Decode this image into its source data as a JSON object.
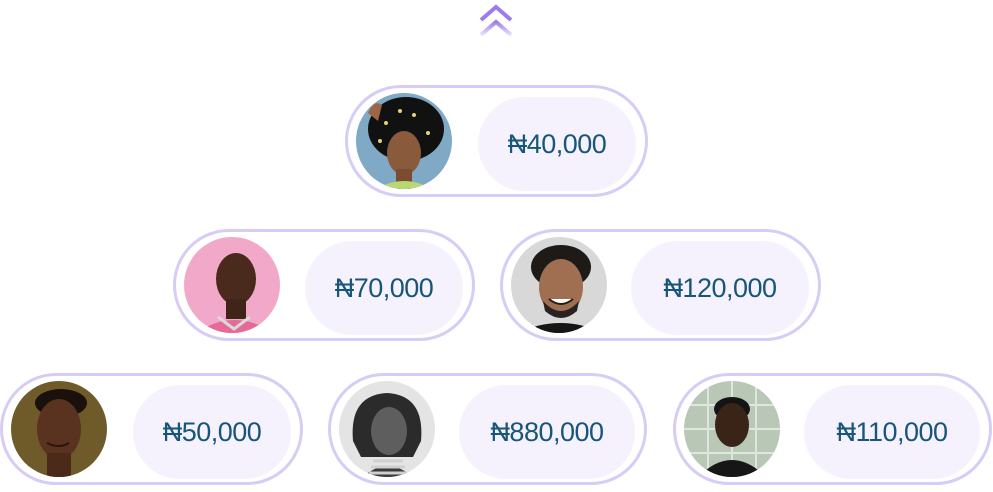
{
  "scroll_up_icon": "double-chevron-up-icon",
  "colors": {
    "card_border": "#d7ccf5",
    "amount_bg": "#f5f2fd",
    "amount_text": "#17557a",
    "chevron": "#9b7bf0"
  },
  "rows": [
    {
      "cards": [
        {
          "amount": "₦40,000",
          "avatar": "woman-curly-hair-avatar"
        }
      ]
    },
    {
      "cards": [
        {
          "amount": "₦70,000",
          "avatar": "bald-man-pink-background-avatar"
        },
        {
          "amount": "₦120,000",
          "avatar": "smiling-man-curly-hair-avatar"
        }
      ]
    },
    {
      "cards": [
        {
          "amount": "₦50,000",
          "avatar": "man-portrait-avatar"
        },
        {
          "amount": "₦880,000",
          "avatar": "woman-bob-hair-avatar"
        },
        {
          "amount": "₦110,000",
          "avatar": "man-tiled-wall-avatar"
        }
      ]
    }
  ]
}
